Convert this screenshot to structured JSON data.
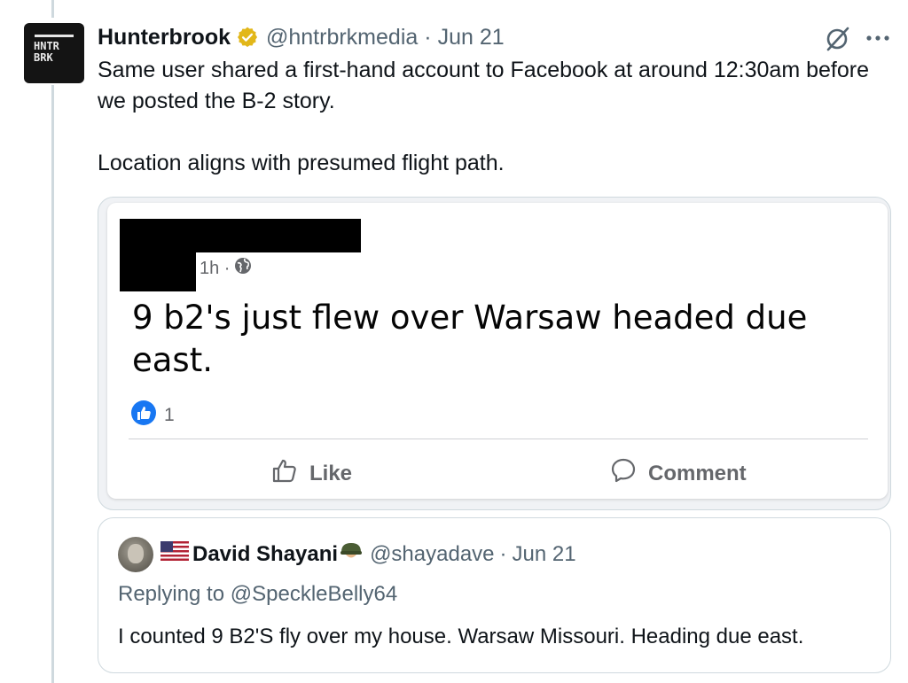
{
  "tweet": {
    "avatar_text_line1": "HNTR",
    "avatar_text_line2": "BRK",
    "name": "Hunterbrook",
    "handle": "@hntrbrkmedia",
    "separator": "·",
    "date": "Jun 21",
    "text_line1": "Same user shared a first-hand account to Facebook at around 12:30am before we posted the B-2 story.",
    "text_line2": "Location aligns with presumed flight path.",
    "verified_color": "#e2b719"
  },
  "facebook_post": {
    "time": "1h ·",
    "text": "9 b2's just flew over Warsaw headed due east.",
    "reaction_count": "1",
    "like_label": "Like",
    "comment_label": "Comment",
    "reaction_color": "#1877f2"
  },
  "quote": {
    "name": "David Shayani",
    "handle": "@shayadave",
    "separator": "·",
    "date": "Jun 21",
    "replying_prefix": "Replying to ",
    "replying_to": "@SpeckleBelly64",
    "text": "I counted 9 B2'S fly over my house. Warsaw Missouri. Heading due east."
  },
  "icons": {
    "verified": "verified-badge-icon",
    "grok": "grok-icon",
    "more": "more-icon",
    "globe": "globe-icon",
    "like_reaction": "thumbs-up-reaction-icon",
    "like": "thumbs-up-icon",
    "comment": "comment-icon",
    "flag": "us-flag-icon",
    "helmet": "helmet-icon"
  }
}
